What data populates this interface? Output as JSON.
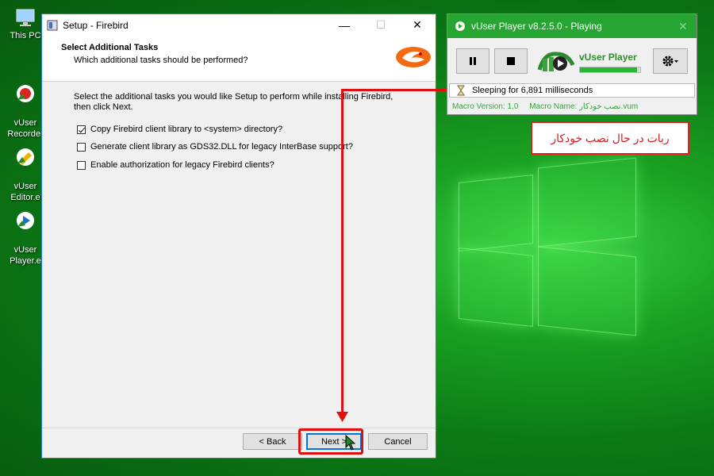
{
  "desktop": {
    "icons": [
      {
        "label": "This PC",
        "icon": "computer-icon"
      },
      {
        "label": "vUser\nRecorder",
        "icon": "vuser-recorder-icon"
      },
      {
        "label": "vUser\nEditor.e",
        "icon": "vuser-editor-icon"
      },
      {
        "label": "vUser\nPlayer.e",
        "icon": "vuser-player-icon"
      }
    ]
  },
  "setup": {
    "title": "Setup - Firebird",
    "header_title": "Select Additional Tasks",
    "header_subtitle": "Which additional tasks should be performed?",
    "intro": "Select the additional tasks you would like Setup to perform while installing Firebird, then click Next.",
    "tasks": [
      {
        "label": "Copy Firebird client library to <system> directory?",
        "checked": true
      },
      {
        "label": "Generate client library as GDS32.DLL for legacy InterBase support?",
        "checked": false
      },
      {
        "label": "Enable authorization for legacy Firebird clients?",
        "checked": false
      }
    ],
    "back_label": "< Back",
    "next_label": "Next >",
    "cancel_label": "Cancel",
    "minimize": "—",
    "maximize": "☐",
    "close": "✕"
  },
  "player": {
    "title": "vUser Player v8.2.5.0 - Playing",
    "brand": "vUser Player",
    "progress": 0.95,
    "status": "Sleeping for 6,891 milliseconds",
    "macro_version_label": "Macro Version:",
    "macro_version": "1.0",
    "macro_name_label": "Macro Name:",
    "macro_name": "نصب خودکار.vum",
    "close": "✕"
  },
  "callout": {
    "text": "ربات در حال نصب خودکار"
  },
  "colors": {
    "accent_red": "#e01010",
    "player_green": "#27a532",
    "window_border": "#1883d7"
  }
}
